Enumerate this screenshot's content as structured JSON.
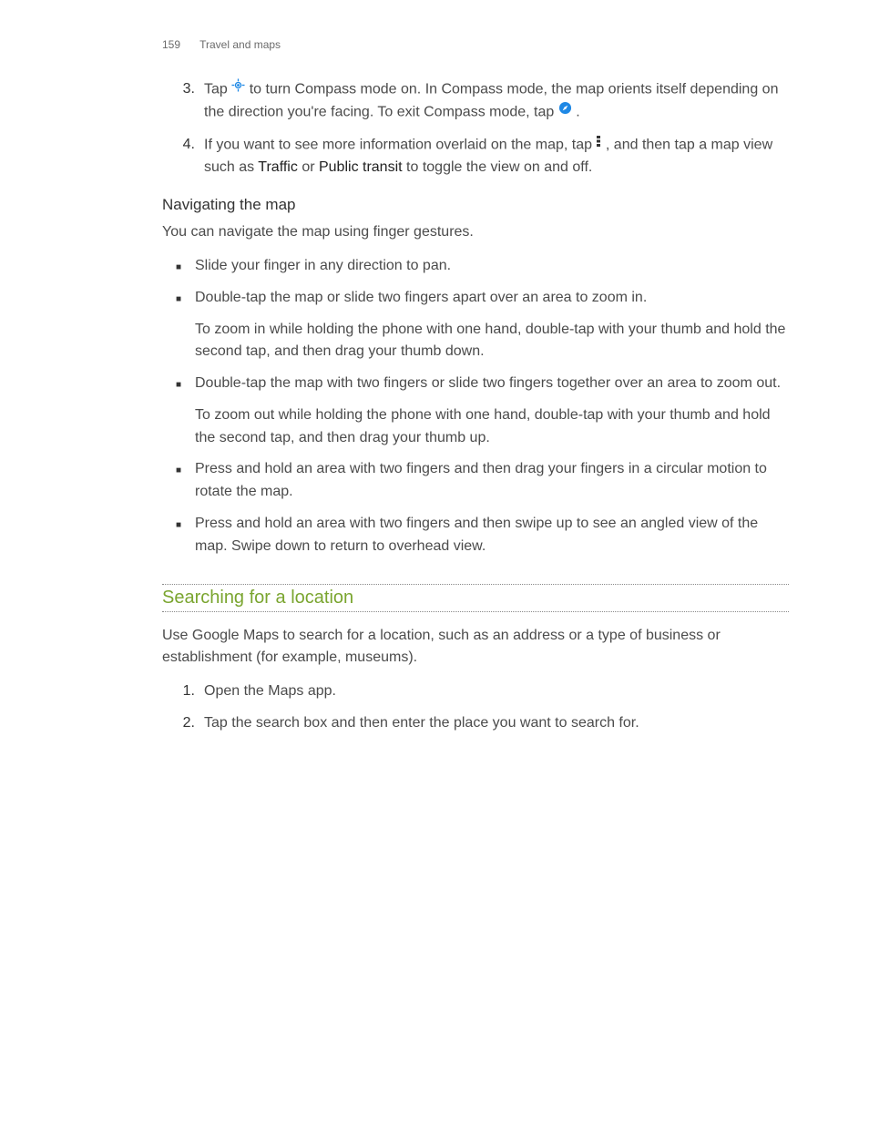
{
  "header": {
    "page_number": "159",
    "section": "Travel and maps"
  },
  "steps_top": [
    {
      "num": "3.",
      "parts": {
        "p1": "Tap ",
        "p2": " to turn Compass mode on. In Compass mode, the map orients itself depending on the direction you're facing. To exit Compass mode, tap ",
        "p3": "."
      }
    },
    {
      "num": "4.",
      "parts": {
        "p1": "If you want to see more information overlaid on the map, tap ",
        "p2": ", and then tap a map view such as ",
        "s1": "Traffic",
        "p3": " or ",
        "s2": "Public transit",
        "p4": " to toggle the view on and off."
      }
    }
  ],
  "nav_heading": "Navigating the map",
  "nav_intro": "You can navigate the map using finger gestures.",
  "nav_bullets": [
    {
      "paras": [
        "Slide your finger in any direction to pan."
      ]
    },
    {
      "paras": [
        "Double-tap the map or slide two fingers apart over an area to zoom in.",
        "To zoom in while holding the phone with one hand, double-tap with your thumb and hold the second tap, and then drag your thumb down."
      ]
    },
    {
      "paras": [
        "Double-tap the map with two fingers or slide two fingers together over an area to zoom out.",
        "To zoom out while holding the phone with one hand, double-tap with your thumb and hold the second tap, and then drag your thumb up."
      ]
    },
    {
      "paras": [
        "Press and hold an area with two fingers and then drag your fingers in a circular motion to rotate the map."
      ]
    },
    {
      "paras": [
        "Press and hold an area with two fingers and then swipe up to see an angled view of the map. Swipe down to return to overhead view."
      ]
    }
  ],
  "search_title": "Searching for a location",
  "search_intro": "Use Google Maps to search for a location, such as an address or a type of business or establishment (for example, museums).",
  "search_steps": [
    {
      "num": "1.",
      "text": "Open the Maps app."
    },
    {
      "num": "2.",
      "text": "Tap the search box and then enter the place you want to search for."
    }
  ]
}
